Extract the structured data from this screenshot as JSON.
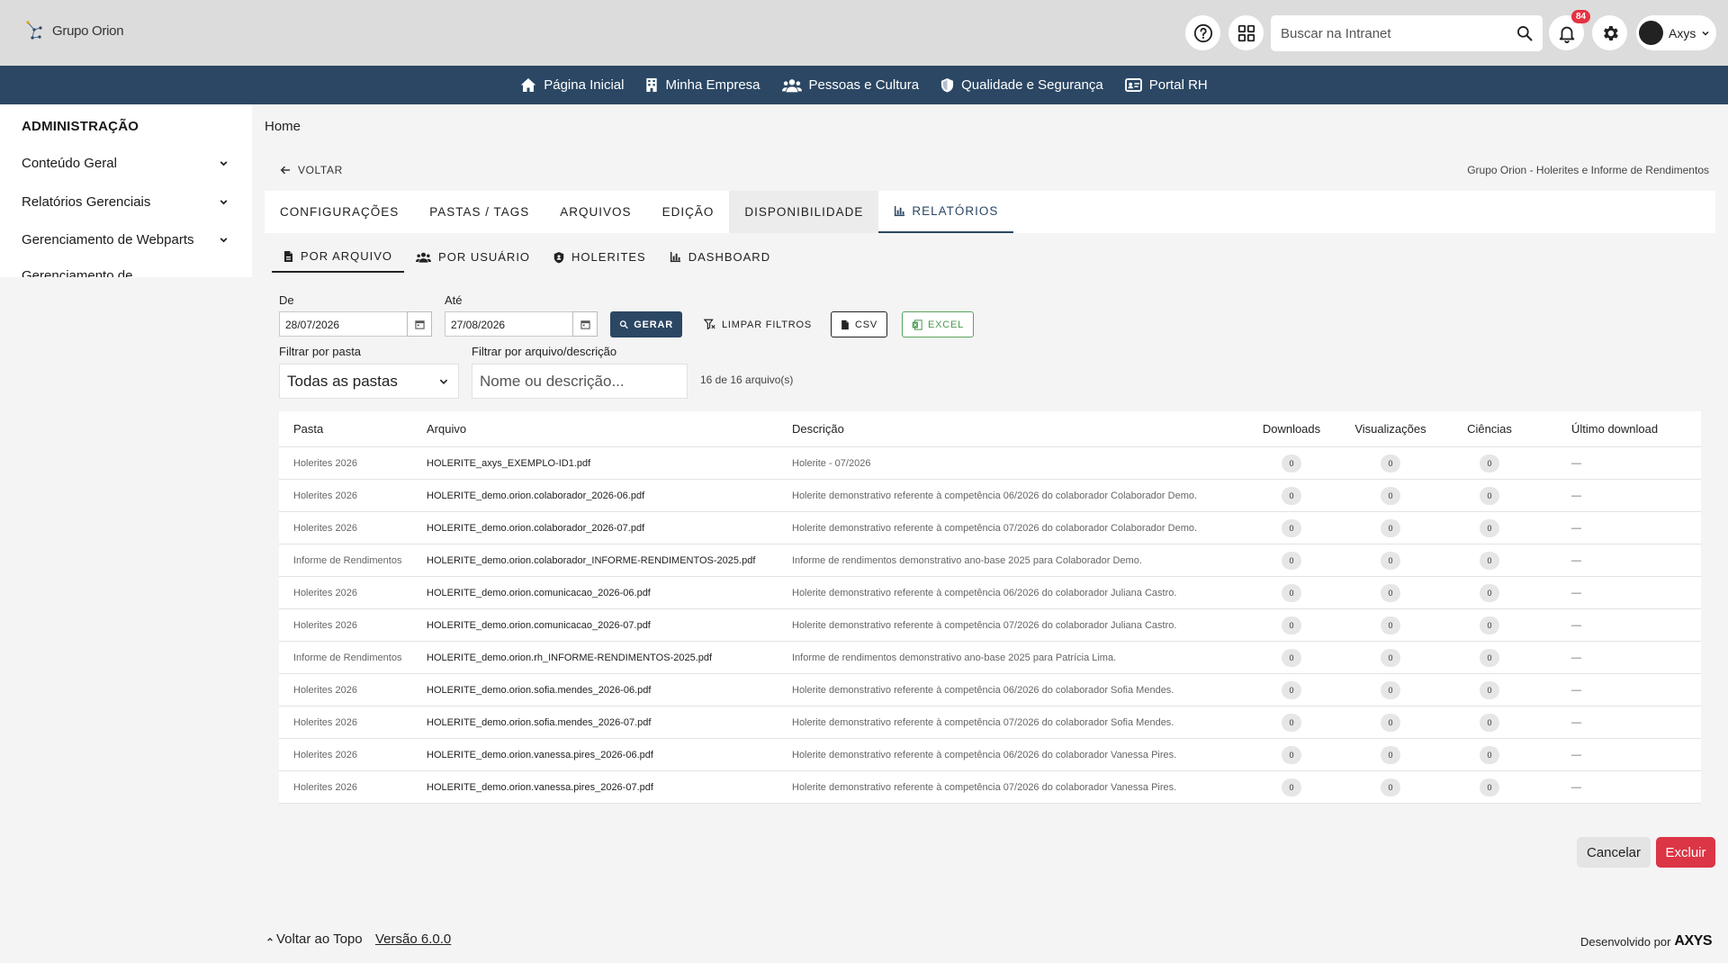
{
  "header": {
    "logo_text": "Grupo Orion",
    "search_placeholder": "Buscar na Intranet",
    "notifications_count": "84",
    "user_name": "Axys"
  },
  "nav": [
    {
      "label": "Página Inicial",
      "icon": "home-icon"
    },
    {
      "label": "Minha Empresa",
      "icon": "building-icon"
    },
    {
      "label": "Pessoas e Cultura",
      "icon": "people-icon"
    },
    {
      "label": "Qualidade e Segurança",
      "icon": "shield-icon"
    },
    {
      "label": "Portal RH",
      "icon": "id-card-icon"
    }
  ],
  "sidebar": {
    "title": "ADMINISTRAÇÃO",
    "items": [
      "Conteúdo Geral",
      "Relatórios Gerenciais",
      "Gerenciamento de Webparts",
      "Gerenciamento de"
    ]
  },
  "breadcrumb": "Home",
  "back_label": "VOLTAR",
  "context_title": "Grupo Orion - Holerites e Informe de Rendimentos",
  "tabs": [
    "CONFIGURAÇÕES",
    "PASTAS / TAGS",
    "ARQUIVOS",
    "EDIÇÃO",
    "DISPONIBILIDADE",
    "RELATÓRIOS"
  ],
  "subtabs": [
    "POR ARQUIVO",
    "POR USUÁRIO",
    "HOLERITES",
    "DASHBOARD"
  ],
  "filters": {
    "from_label": "De",
    "from_value": "28/07/2026",
    "to_label": "Até",
    "to_value": "27/08/2026",
    "generate": "GERAR",
    "clear": "LIMPAR FILTROS",
    "csv": "CSV",
    "excel": "EXCEL",
    "folder_label": "Filtrar por pasta",
    "folder_value": "Todas as pastas",
    "file_label": "Filtrar por arquivo/descrição",
    "file_placeholder": "Nome ou descrição...",
    "count": "16 de 16 arquivo(s)"
  },
  "table": {
    "headers": [
      "Pasta",
      "Arquivo",
      "Descrição",
      "Downloads",
      "Visualizações",
      "Ciências",
      "Último download"
    ],
    "rows": [
      {
        "pasta": "Holerites 2026",
        "arquivo": "HOLERITE_axys_EXEMPLO-ID1.pdf",
        "descricao": "Holerite - 07/2026",
        "downloads": "0",
        "views": "0",
        "ciencias": "0",
        "ultimo": "—"
      },
      {
        "pasta": "Holerites 2026",
        "arquivo": "HOLERITE_demo.orion.colaborador_2026-06.pdf",
        "descricao": "Holerite demonstrativo referente à competência 06/2026 do colaborador Colaborador Demo.",
        "downloads": "0",
        "views": "0",
        "ciencias": "0",
        "ultimo": "—"
      },
      {
        "pasta": "Holerites 2026",
        "arquivo": "HOLERITE_demo.orion.colaborador_2026-07.pdf",
        "descricao": "Holerite demonstrativo referente à competência 07/2026 do colaborador Colaborador Demo.",
        "downloads": "0",
        "views": "0",
        "ciencias": "0",
        "ultimo": "—"
      },
      {
        "pasta": "Informe de Rendimentos",
        "arquivo": "HOLERITE_demo.orion.colaborador_INFORME-RENDIMENTOS-2025.pdf",
        "descricao": "Informe de rendimentos demonstrativo ano-base 2025 para Colaborador Demo.",
        "downloads": "0",
        "views": "0",
        "ciencias": "0",
        "ultimo": "—"
      },
      {
        "pasta": "Holerites 2026",
        "arquivo": "HOLERITE_demo.orion.comunicacao_2026-06.pdf",
        "descricao": "Holerite demonstrativo referente à competência 06/2026 do colaborador Juliana Castro.",
        "downloads": "0",
        "views": "0",
        "ciencias": "0",
        "ultimo": "—"
      },
      {
        "pasta": "Holerites 2026",
        "arquivo": "HOLERITE_demo.orion.comunicacao_2026-07.pdf",
        "descricao": "Holerite demonstrativo referente à competência 07/2026 do colaborador Juliana Castro.",
        "downloads": "0",
        "views": "0",
        "ciencias": "0",
        "ultimo": "—"
      },
      {
        "pasta": "Informe de Rendimentos",
        "arquivo": "HOLERITE_demo.orion.rh_INFORME-RENDIMENTOS-2025.pdf",
        "descricao": "Informe de rendimentos demonstrativo ano-base 2025 para Patrícia Lima.",
        "downloads": "0",
        "views": "0",
        "ciencias": "0",
        "ultimo": "—"
      },
      {
        "pasta": "Holerites 2026",
        "arquivo": "HOLERITE_demo.orion.sofia.mendes_2026-06.pdf",
        "descricao": "Holerite demonstrativo referente à competência 06/2026 do colaborador Sofia Mendes.",
        "downloads": "0",
        "views": "0",
        "ciencias": "0",
        "ultimo": "—"
      },
      {
        "pasta": "Holerites 2026",
        "arquivo": "HOLERITE_demo.orion.sofia.mendes_2026-07.pdf",
        "descricao": "Holerite demonstrativo referente à competência 07/2026 do colaborador Sofia Mendes.",
        "downloads": "0",
        "views": "0",
        "ciencias": "0",
        "ultimo": "—"
      },
      {
        "pasta": "Holerites 2026",
        "arquivo": "HOLERITE_demo.orion.vanessa.pires_2026-06.pdf",
        "descricao": "Holerite demonstrativo referente à competência 06/2026 do colaborador Vanessa Pires.",
        "downloads": "0",
        "views": "0",
        "ciencias": "0",
        "ultimo": "—"
      },
      {
        "pasta": "Holerites 2026",
        "arquivo": "HOLERITE_demo.orion.vanessa.pires_2026-07.pdf",
        "descricao": "Holerite demonstrativo referente à competência 07/2026 do colaborador Vanessa Pires.",
        "downloads": "0",
        "views": "0",
        "ciencias": "0",
        "ultimo": "—"
      }
    ]
  },
  "actions": {
    "cancel": "Cancelar",
    "delete": "Excluir"
  },
  "footer": {
    "back_top": "Voltar ao Topo",
    "version": "Versão 6.0.0",
    "developed_by": "Desenvolvido por",
    "brand": "AXYS"
  },
  "colors": {
    "primary": "#2b4764",
    "danger": "#dc3545",
    "success": "#4c9a50",
    "badge": "#e53241"
  }
}
